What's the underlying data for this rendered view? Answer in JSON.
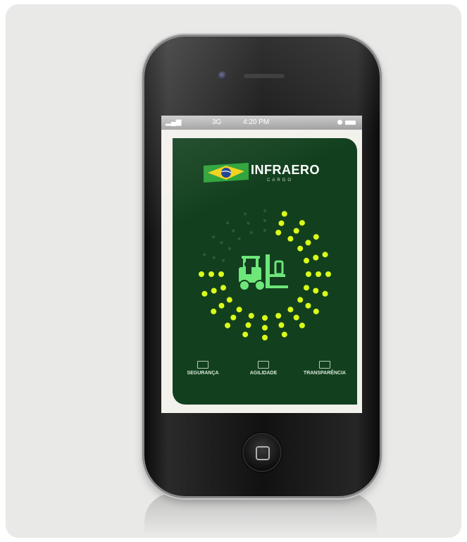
{
  "status_bar": {
    "signal": "▂▄▆",
    "network": "3G",
    "time": "4:20 PM"
  },
  "app": {
    "logo_text": "INFRAERO",
    "logo_subtext": "CARGO",
    "menu": [
      {
        "label": "SEGURANÇA",
        "icon": "shield-grid-icon"
      },
      {
        "label": "AGILIDADE",
        "icon": "timer-icon"
      },
      {
        "label": "TRANSPARÊNCIA",
        "icon": "eye-icon"
      }
    ],
    "colors": {
      "panel_green": "#12401e",
      "accent_yellow": "#d9ff1a",
      "forklift_green": "#6ee67a"
    }
  }
}
